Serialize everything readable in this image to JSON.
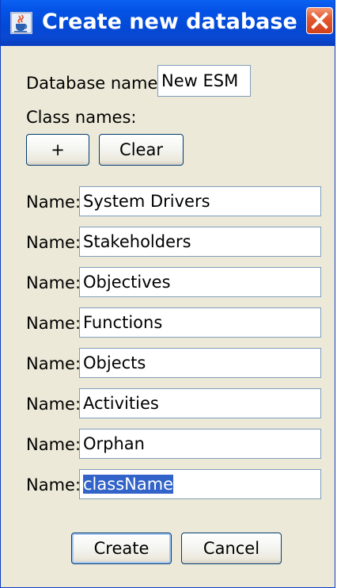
{
  "window": {
    "title": "Create new database",
    "title_icon": "java-cup-icon",
    "close_icon": "close-icon"
  },
  "database_name": {
    "label": "Database name:",
    "value": "New ESM"
  },
  "class_names": {
    "label": "Class names:",
    "add_label": "+",
    "clear_label": "Clear"
  },
  "rows": [
    {
      "label": "Name:",
      "value": "System Drivers"
    },
    {
      "label": "Name:",
      "value": "Stakeholders"
    },
    {
      "label": "Name:",
      "value": "Objectives"
    },
    {
      "label": "Name:",
      "value": "Functions"
    },
    {
      "label": "Name:",
      "value": "Objects"
    },
    {
      "label": "Name:",
      "value": "Activities"
    },
    {
      "label": "Name:",
      "value": "Orphan"
    },
    {
      "label": "Name:",
      "value": "className"
    }
  ],
  "buttons": {
    "create_label": "Create",
    "cancel_label": "Cancel"
  },
  "colors": {
    "title_bar": "#0454e8",
    "dialog_background": "#ece9d8",
    "close_button": "#e45a30",
    "selection": "#3163c8"
  }
}
